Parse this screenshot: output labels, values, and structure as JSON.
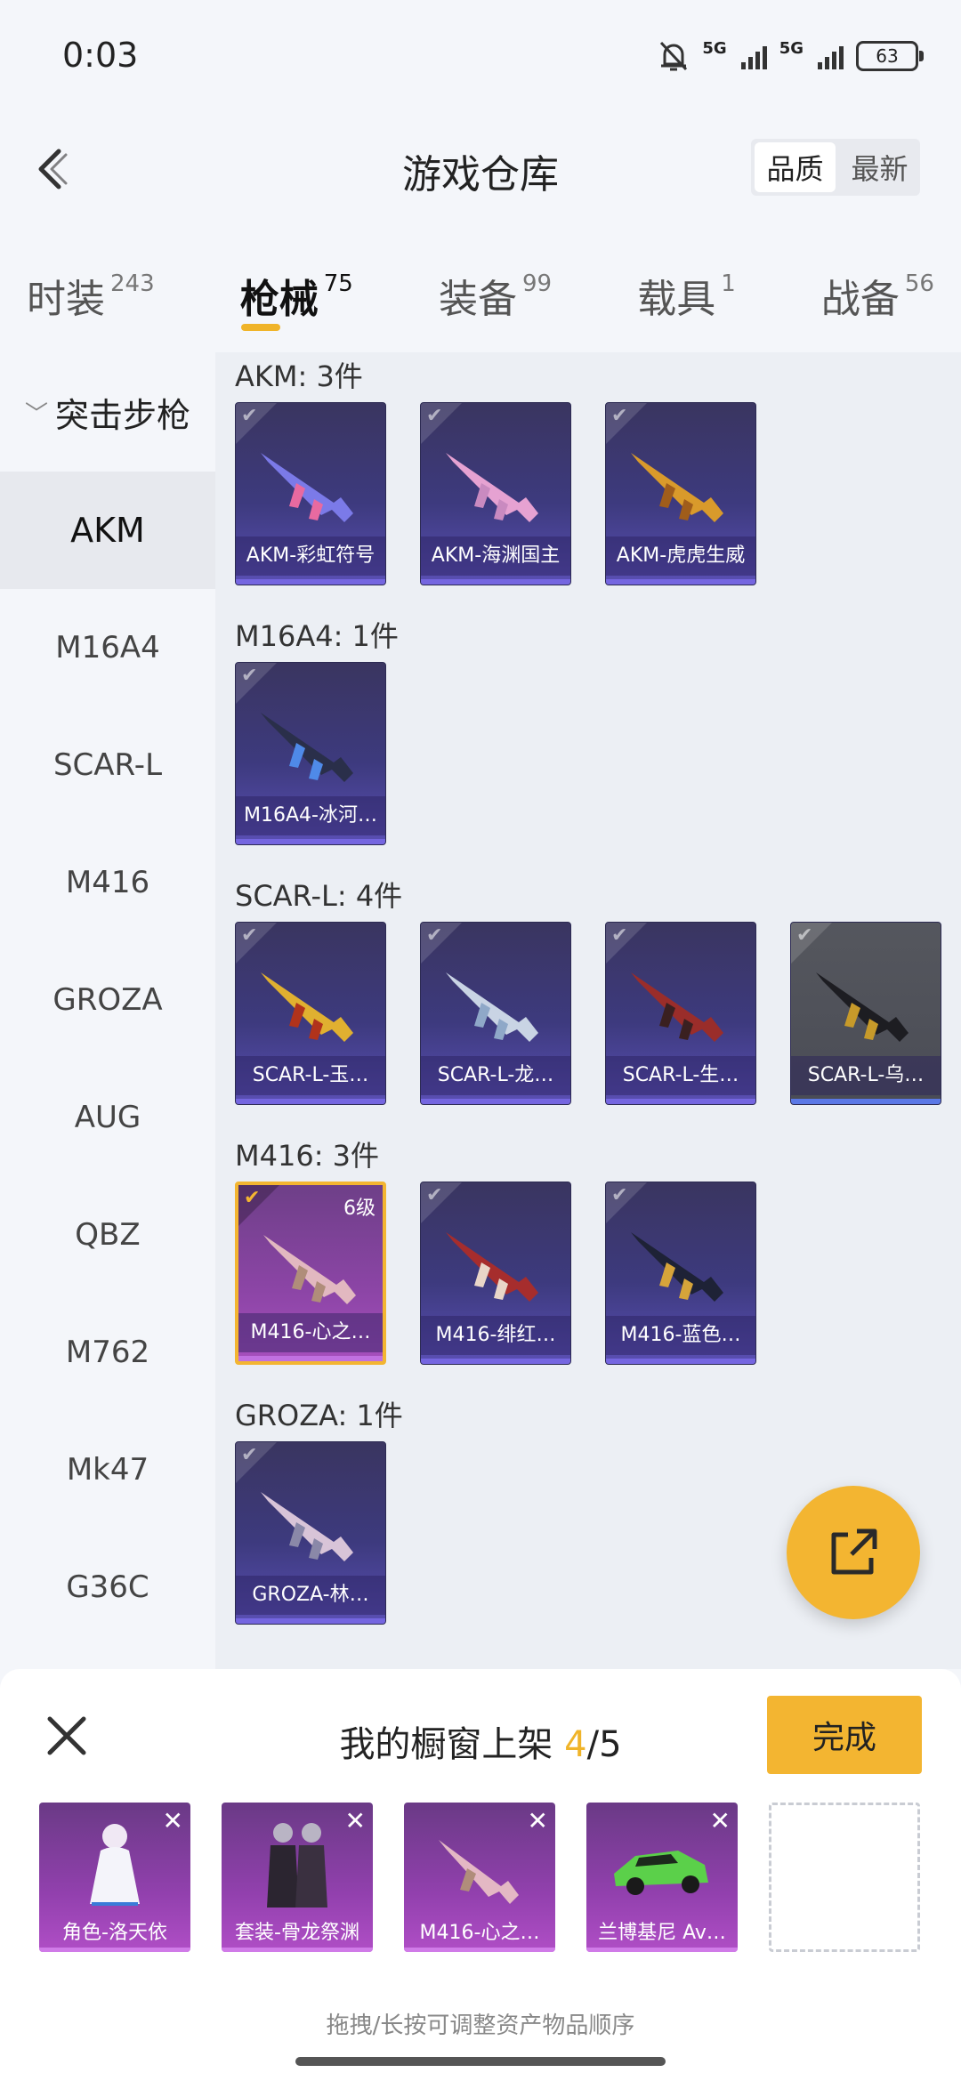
{
  "status_bar": {
    "time": "0:03",
    "net1": "5G",
    "net2": "5G",
    "battery": "63"
  },
  "header": {
    "title": "游戏仓库",
    "sort_quality": "品质",
    "sort_newest": "最新"
  },
  "tabs": [
    {
      "label": "时装",
      "count": "243"
    },
    {
      "label": "枪械",
      "count": "75",
      "active": true
    },
    {
      "label": "装备",
      "count": "99"
    },
    {
      "label": "载具",
      "count": "1"
    },
    {
      "label": "战备",
      "count": "56"
    }
  ],
  "sidebar": {
    "category": "突击步枪",
    "items": [
      "AKM",
      "M16A4",
      "SCAR-L",
      "M416",
      "GROZA",
      "AUG",
      "QBZ",
      "M762",
      "Mk47",
      "G36C"
    ]
  },
  "groups": [
    {
      "label": "AKM: 3件",
      "items": [
        {
          "name": "AKM-彩虹符号",
          "colors": [
            "#7b7ae8",
            "#e86aa0"
          ]
        },
        {
          "name": "AKM-海渊国主",
          "colors": [
            "#e6a2d2",
            "#c98ac0"
          ]
        },
        {
          "name": "AKM-虎虎生威",
          "colors": [
            "#d99a2b",
            "#a05d1b"
          ]
        }
      ]
    },
    {
      "label": "M16A4: 1件",
      "items": [
        {
          "name": "M16A4-冰河…",
          "colors": [
            "#2a2f4a",
            "#4f8ae8"
          ]
        }
      ]
    },
    {
      "label": "SCAR-L: 4件",
      "items": [
        {
          "name": "SCAR-L-玉…",
          "colors": [
            "#e0b030",
            "#b1331b"
          ]
        },
        {
          "name": "SCAR-L-龙…",
          "colors": [
            "#c9d4e4",
            "#8fa8c8"
          ]
        },
        {
          "name": "SCAR-L-生…",
          "colors": [
            "#9a2d2a",
            "#3a2020"
          ]
        },
        {
          "name": "SCAR-L-乌…",
          "colors": [
            "#1d1d22",
            "#c79a2a"
          ],
          "grey": true
        }
      ]
    },
    {
      "label": "M416: 3件",
      "items": [
        {
          "name": "M416-心之…",
          "colors": [
            "#e2b8c0",
            "#b08d7a"
          ],
          "selected": true,
          "level": "6级"
        },
        {
          "name": "M416-绯红…",
          "colors": [
            "#a62d2d",
            "#e9d6c8"
          ]
        },
        {
          "name": "M416-蓝色…",
          "colors": [
            "#1e2236",
            "#d6a43a"
          ]
        }
      ]
    },
    {
      "label": "GROZA: 1件",
      "items": [
        {
          "name": "GROZA-林…",
          "colors": [
            "#d8c4d8",
            "#8a88a8"
          ]
        }
      ]
    }
  ],
  "panel": {
    "title_prefix": "我的橱窗上架 ",
    "current": "4",
    "total": "/5",
    "done": "完成",
    "slots": [
      {
        "name": "角色-洛天依"
      },
      {
        "name": "套装-骨龙祭渊"
      },
      {
        "name": "M416-心之…"
      },
      {
        "name": "兰博基尼 Av…"
      }
    ],
    "hint": "拖拽/长按可调整资产物品顺序"
  }
}
